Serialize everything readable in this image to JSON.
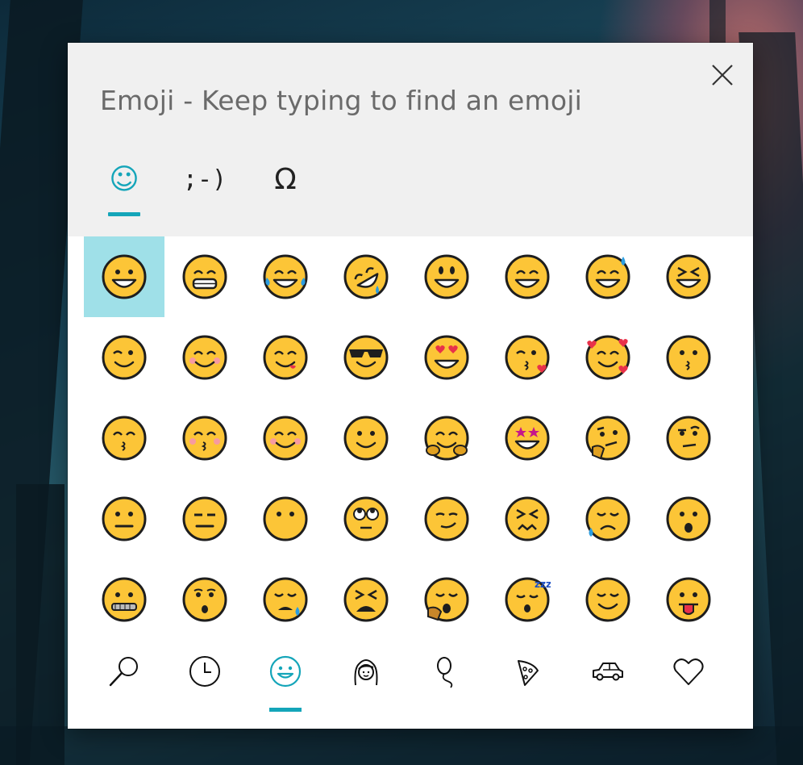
{
  "dialog": {
    "title": "Emoji - Keep typing to find an emoji",
    "close_icon": "close-icon"
  },
  "tabs": [
    {
      "name": "emoji",
      "label": "☺",
      "active": true
    },
    {
      "name": "kaomoji",
      "label": ";-)",
      "active": false
    },
    {
      "name": "symbols",
      "label": "Ω",
      "active": false
    }
  ],
  "emoji_grid": {
    "selected_index": 0,
    "items": [
      "grinning-face",
      "grimacing-face",
      "face-with-tears-of-joy",
      "rolling-on-floor-laughing",
      "smiley",
      "smile",
      "sweat-smile",
      "laughing-squinting",
      "winking-face",
      "smiling-face-with-smiling-eyes",
      "face-savoring-food",
      "smiling-face-with-sunglasses",
      "heart-eyes",
      "face-blowing-kiss",
      "smiling-face-with-hearts",
      "kissing-face",
      "kissing-face-smiling-eyes",
      "kissing-face-closed-eyes",
      "smiling-face-rosy-cheeks",
      "slightly-smiling-face",
      "hugging-face",
      "star-struck",
      "thinking-face",
      "face-raised-eyebrow",
      "neutral-face",
      "expressionless-face",
      "face-without-mouth",
      "face-rolling-eyes",
      "smirking-face",
      "persevering-face",
      "sad-relieved-face",
      "face-open-mouth",
      "zipper-mouth-face",
      "hushed-face",
      "sleepy-face",
      "tired-face",
      "yawning-face",
      "sleeping-face",
      "relieved-face",
      "face-with-tongue"
    ]
  },
  "category_bar": [
    {
      "name": "search",
      "icon": "search-icon",
      "active": false
    },
    {
      "name": "recent",
      "icon": "clock-icon",
      "active": false
    },
    {
      "name": "smileys",
      "icon": "smiley-icon",
      "active": true
    },
    {
      "name": "people",
      "icon": "person-icon",
      "active": false
    },
    {
      "name": "celebration",
      "icon": "balloon-icon",
      "active": false
    },
    {
      "name": "food",
      "icon": "pizza-icon",
      "active": false
    },
    {
      "name": "travel",
      "icon": "car-icon",
      "active": false
    },
    {
      "name": "symbols",
      "icon": "heart-icon",
      "active": false
    }
  ],
  "colors": {
    "accent": "#14a5b9",
    "selected_cell": "#9fe0e8",
    "emoji_fill": "#fcc537",
    "emoji_outline": "#1e1e1e",
    "header_bg": "#f0f0f0"
  }
}
